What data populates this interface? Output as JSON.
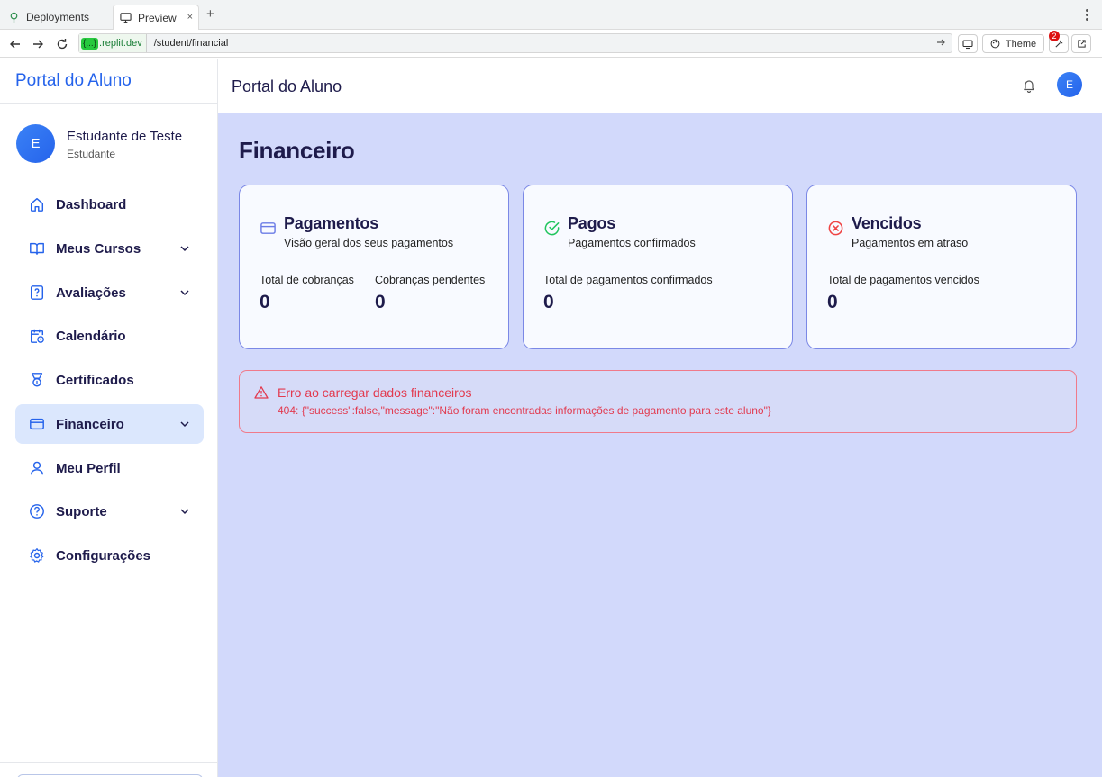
{
  "browser": {
    "tabs": [
      {
        "label": "Deployments",
        "icon": "tree-icon"
      },
      {
        "label": "Preview",
        "icon": "monitor-icon",
        "close": "×"
      }
    ],
    "new_tab": "+",
    "url_host_badge": "{...}",
    "url_host": ".replit.dev",
    "url_path": "/student/financial",
    "theme_label": "Theme",
    "devtools_badge": "2"
  },
  "sidebar": {
    "brand": "Portal do Aluno",
    "user": {
      "initial": "E",
      "name": "Estudante de Teste",
      "role": "Estudante"
    },
    "items": [
      {
        "label": "Dashboard",
        "icon": "home-icon",
        "has_chevron": false
      },
      {
        "label": "Meus Cursos",
        "icon": "book-icon",
        "has_chevron": true
      },
      {
        "label": "Avaliações",
        "icon": "quiz-icon",
        "has_chevron": true
      },
      {
        "label": "Calendário",
        "icon": "calendar-clock-icon",
        "has_chevron": false
      },
      {
        "label": "Certificados",
        "icon": "award-icon",
        "has_chevron": false
      },
      {
        "label": "Financeiro",
        "icon": "credit-card-icon",
        "has_chevron": true,
        "active": true
      },
      {
        "label": "Meu Perfil",
        "icon": "user-icon",
        "has_chevron": false
      },
      {
        "label": "Suporte",
        "icon": "help-circle-icon",
        "has_chevron": true
      },
      {
        "label": "Configurações",
        "icon": "gear-icon",
        "has_chevron": false
      }
    ]
  },
  "header": {
    "title": "Portal do Aluno",
    "avatar_initial": "E"
  },
  "main": {
    "title": "Financeiro",
    "cards": [
      {
        "title": "Pagamentos",
        "subtitle": "Visão geral dos seus pagamentos",
        "icon": "credit-card-icon",
        "stats": [
          {
            "label": "Total de cobranças",
            "value": "0"
          },
          {
            "label": "Cobranças pendentes",
            "value": "0"
          }
        ]
      },
      {
        "title": "Pagos",
        "subtitle": "Pagamentos confirmados",
        "icon": "check-circle-icon",
        "stats": [
          {
            "label": "Total de pagamentos confirmados",
            "value": "0"
          }
        ]
      },
      {
        "title": "Vencidos",
        "subtitle": "Pagamentos em atraso",
        "icon": "x-circle-icon",
        "stats": [
          {
            "label": "Total de pagamentos vencidos",
            "value": "0"
          }
        ]
      }
    ],
    "alert": {
      "title": "Erro ao carregar dados financeiros",
      "message": "404: {\"success\":false,\"message\":\"Não foram encontradas informações de pagamento para este aluno\"}"
    }
  },
  "colors": {
    "accent": "#2563eb",
    "main_bg": "#d2d9fb",
    "card_border": "#7b88e6",
    "error": "#e23a4f",
    "success": "#22c55e",
    "danger_icon": "#ef4444"
  }
}
